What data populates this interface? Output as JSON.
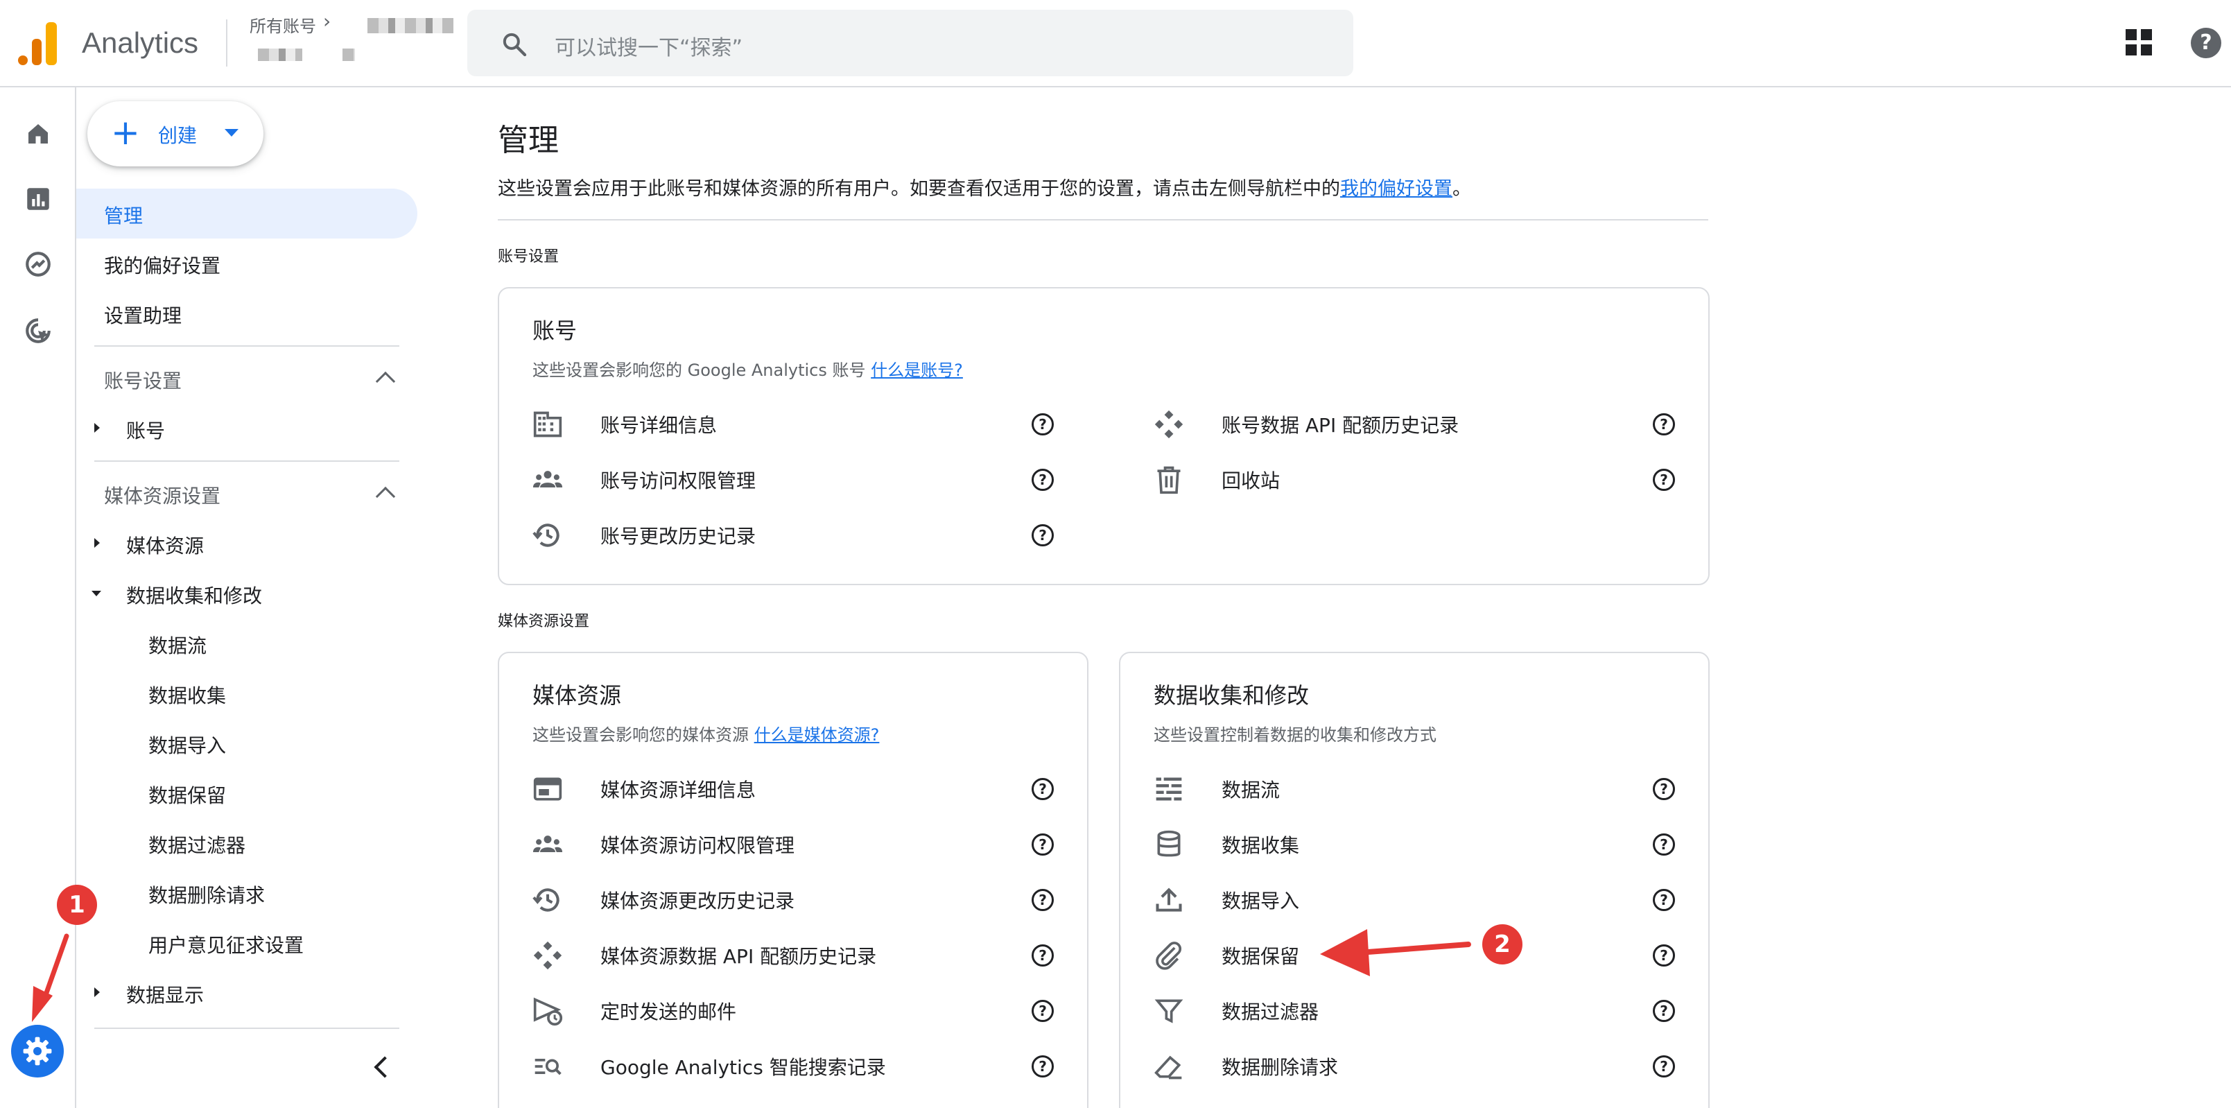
{
  "app": {
    "title": "Analytics",
    "breadcrumb_all_accounts": "所有账号",
    "search_placeholder": "可以试搜一下“探索”"
  },
  "create_button": {
    "label": "创建"
  },
  "sidebar": {
    "admin": "管理",
    "my_preferences": "我的偏好设置",
    "setup_assistant": "设置助理",
    "account_settings_header": "账号设置",
    "account": "账号",
    "property_settings_header": "媒体资源设置",
    "property": "媒体资源",
    "data_collection_modification": "数据收集和修改",
    "sub_items": [
      "数据流",
      "数据收集",
      "数据导入",
      "数据保留",
      "数据过滤器",
      "数据删除请求",
      "用户意见征求设置"
    ],
    "data_display": "数据显示"
  },
  "main": {
    "title": "管理",
    "description_prefix": "这些设置会应用于此账号和媒体资源的所有用户。如要查看仅适用于您的设置，请点击左侧导航栏中的",
    "description_link": "我的偏好设置",
    "description_suffix": "。",
    "account_section_label": "账号设置",
    "property_section_label": "媒体资源设置"
  },
  "account_card": {
    "title": "账号",
    "subtitle": "这些设置会影响您的 Google Analytics 账号",
    "subtitle_link": "什么是账号?",
    "items_left": [
      "账号详细信息",
      "账号访问权限管理",
      "账号更改历史记录"
    ],
    "items_right": [
      "账号数据 API 配额历史记录",
      "回收站"
    ]
  },
  "property_card": {
    "title": "媒体资源",
    "subtitle": "这些设置会影响您的媒体资源",
    "subtitle_link": "什么是媒体资源?",
    "items": [
      "媒体资源详细信息",
      "媒体资源访问权限管理",
      "媒体资源更改历史记录",
      "媒体资源数据 API 配额历史记录",
      "定时发送的邮件",
      "Google Analytics 智能搜索记录"
    ]
  },
  "data_card": {
    "title": "数据收集和修改",
    "subtitle": "这些设置控制着数据的收集和修改方式",
    "items": [
      "数据流",
      "数据收集",
      "数据导入",
      "数据保留",
      "数据过滤器",
      "数据删除请求"
    ]
  },
  "help_glyph": "?",
  "annotations": {
    "badge1": "1",
    "badge2": "2"
  },
  "colors": {
    "accent": "#1a73e8",
    "annotation": "#e53935",
    "active_bg": "#e8f0fe"
  }
}
